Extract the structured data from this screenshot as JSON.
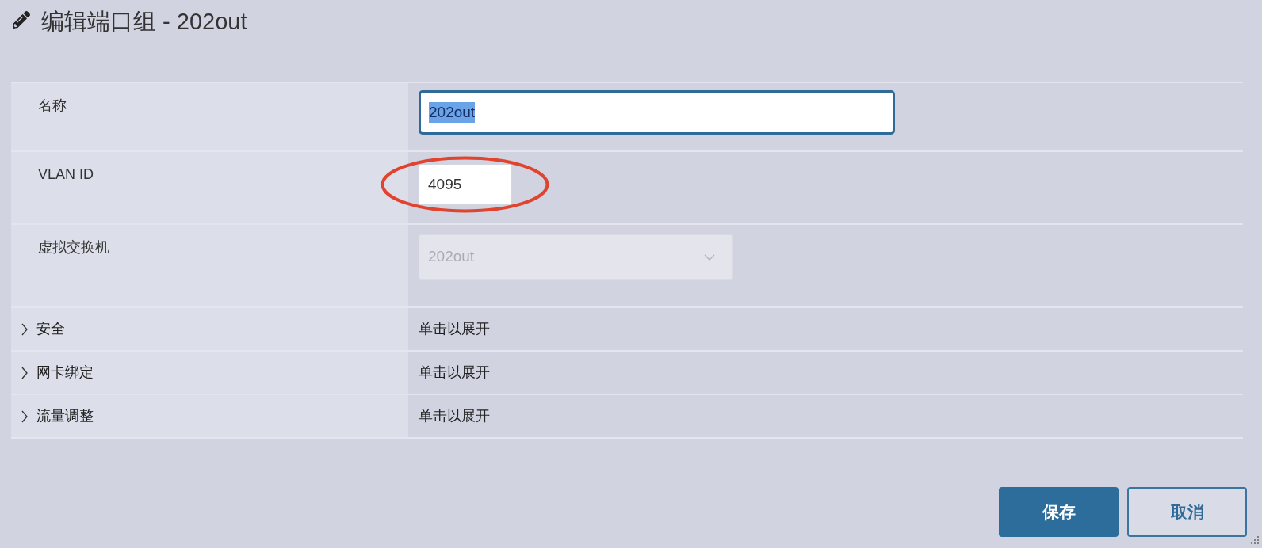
{
  "window": {
    "title": "编辑端口组 - 202out"
  },
  "fields": [
    {
      "kind": "text",
      "label": "名称",
      "value": "202out",
      "text_selected": true,
      "focused": true
    },
    {
      "kind": "number",
      "label": "VLAN ID",
      "value": "4095",
      "focused": false,
      "circled": true
    },
    {
      "kind": "select",
      "label": "虚拟交换机",
      "value": "202out",
      "disabled": true
    }
  ],
  "sections": [
    {
      "label": "安全",
      "hint": "单击以展开",
      "expanded": false
    },
    {
      "label": "网卡绑定",
      "hint": "单击以展开",
      "expanded": false
    },
    {
      "label": "流量调整",
      "hint": "单击以展开",
      "expanded": false
    }
  ],
  "buttons": [
    {
      "label": "保存",
      "kind": "primary"
    },
    {
      "label": "取消",
      "kind": "secondary"
    }
  ]
}
